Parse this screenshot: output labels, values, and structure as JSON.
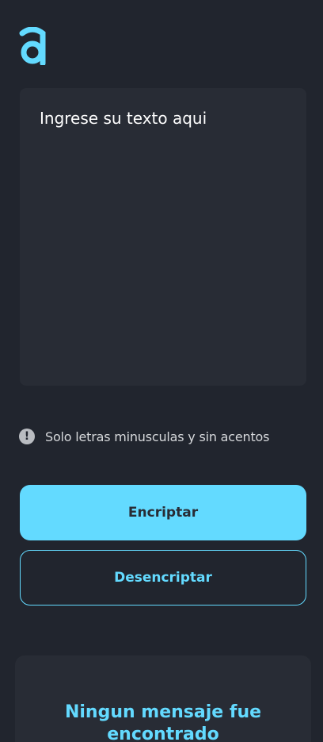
{
  "colors": {
    "background": "#21252e",
    "panel": "#282c35",
    "accent": "#63daff",
    "hint_text": "#d6d8db"
  },
  "logo": {
    "icon": "alura-a-logo-icon"
  },
  "input": {
    "placeholder": "Ingrese su texto aqui",
    "value": ""
  },
  "hint": {
    "icon": "exclamation-circle-icon",
    "icon_glyph": "!",
    "text": "Solo letras minusculas y sin acentos"
  },
  "buttons": {
    "encrypt_label": "Encriptar",
    "decrypt_label": "Desencriptar"
  },
  "result": {
    "title": "Ningun mensaje fue encontrado"
  }
}
